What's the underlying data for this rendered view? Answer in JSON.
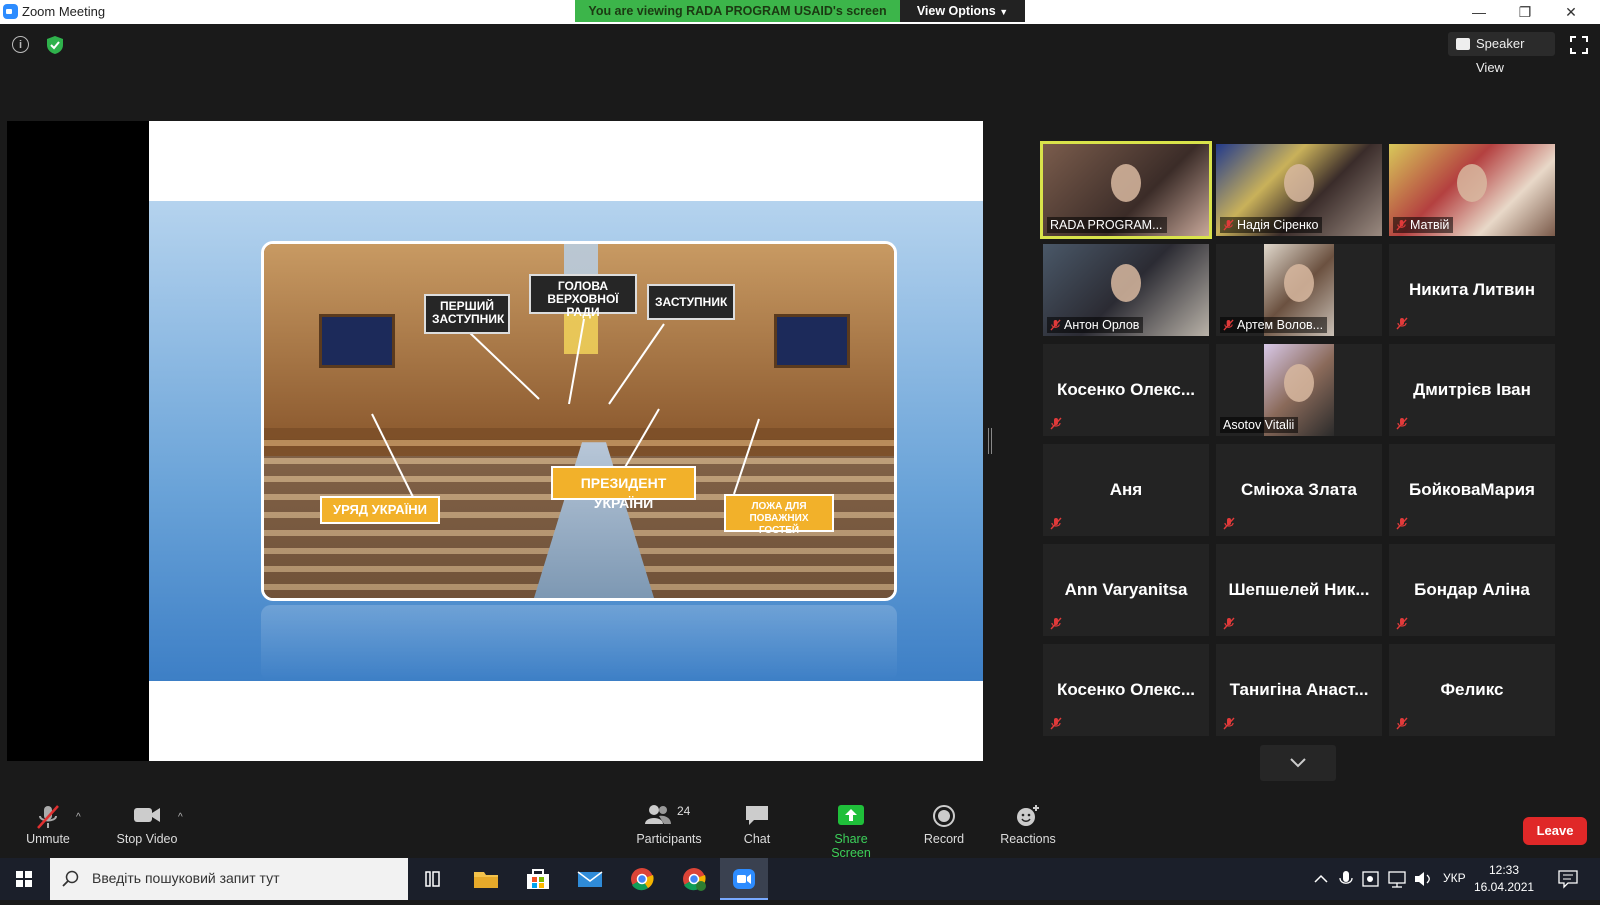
{
  "window": {
    "title": "Zoom Meeting",
    "viewing_banner": "You are viewing RADA PROGRAM USAID's screen",
    "view_options": "View Options",
    "minimize": "—",
    "restore": "❐",
    "close": "✕"
  },
  "topbar": {
    "speaker_view": "Speaker View"
  },
  "slide": {
    "tag_first_deputy": "ПЕРШИЙ ЗАСТУПНИК",
    "tag_head": "ГОЛОВА ВЕРХОВНОЇ РАДИ",
    "tag_deputy": "ЗАСТУПНИК",
    "tag_president": "ПРЕЗИДЕНТ УКРАЇНИ",
    "tag_government": "УРЯД УКРАЇНИ",
    "tag_guests": "ЛОЖА ДЛЯ ПОВАЖНИХ ГОСТЕЙ"
  },
  "gallery": {
    "participants": [
      {
        "name": "RADA PROGRAM...",
        "video": true,
        "muted": false,
        "active": true
      },
      {
        "name": "Надія Сіренко",
        "video": true,
        "muted": true
      },
      {
        "name": "Матвій",
        "video": true,
        "muted": true
      },
      {
        "name": "Антон Орлов",
        "video": true,
        "muted": true
      },
      {
        "name": "Артем Волов...",
        "video": true,
        "muted": true
      },
      {
        "name": "Никита Литвин",
        "video": false,
        "muted": true
      },
      {
        "name": "Косенко Олекс...",
        "video": false,
        "muted": true
      },
      {
        "name": "Asotov Vitalii",
        "video": true,
        "muted": false
      },
      {
        "name": "Дмитрієв Іван",
        "video": false,
        "muted": true
      },
      {
        "name": "Аня",
        "video": false,
        "muted": true
      },
      {
        "name": "Сміюха Злата",
        "video": false,
        "muted": true
      },
      {
        "name": "БойковаМария",
        "video": false,
        "muted": true
      },
      {
        "name": "Ann Varyanitsa",
        "video": false,
        "muted": true
      },
      {
        "name": "Шепшелей Ник...",
        "video": false,
        "muted": true
      },
      {
        "name": "Бондар Аліна",
        "video": false,
        "muted": true
      },
      {
        "name": "Косенко Олекс...",
        "video": false,
        "muted": true
      },
      {
        "name": "Танигіна Анаст...",
        "video": false,
        "muted": true
      },
      {
        "name": "Феликс",
        "video": false,
        "muted": true
      }
    ]
  },
  "toolbar": {
    "unmute": "Unmute",
    "stop_video": "Stop Video",
    "participants": "Participants",
    "participants_count": "24",
    "chat": "Chat",
    "share_screen": "Share Screen",
    "record": "Record",
    "reactions": "Reactions",
    "leave": "Leave"
  },
  "taskbar": {
    "search_placeholder": "Введіть пошуковий запит тут",
    "language": "УКР",
    "time": "12:33",
    "date": "16.04.2021"
  },
  "colors": {
    "banner_green": "#3cb54a",
    "active_speaker": "#d9e34a",
    "leave_red": "#e02828",
    "share_green": "#3cd05a"
  }
}
